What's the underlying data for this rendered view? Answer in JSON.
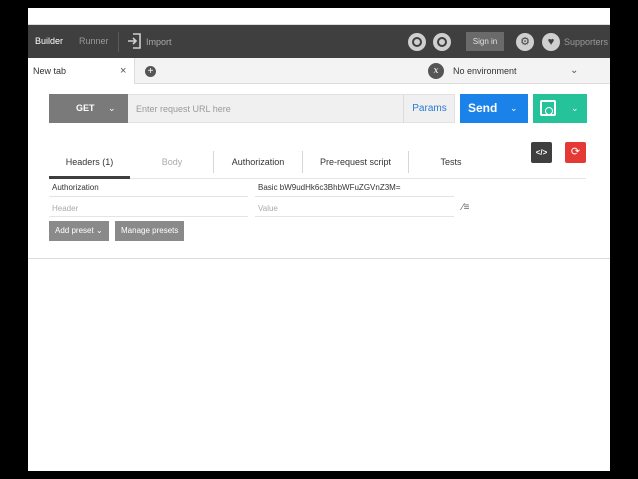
{
  "header": {
    "builder": "Builder",
    "runner": "Runner",
    "import": "Import",
    "sign_in": "Sign in",
    "supporters": "Supporters"
  },
  "tabs": {
    "active": "New tab",
    "close": "×",
    "add": "+"
  },
  "environment": {
    "icon_letter": "x",
    "label": "No environment"
  },
  "request": {
    "method": "GET",
    "url_placeholder": "Enter request URL here",
    "url_value": "",
    "params": "Params",
    "send": "Send"
  },
  "request_tabs": [
    {
      "label": "Headers (1)"
    },
    {
      "label": "Body"
    },
    {
      "label": "Authorization"
    },
    {
      "label": "Pre-request script"
    },
    {
      "label": "Tests"
    }
  ],
  "code_button": "</>",
  "headers_rows": [
    {
      "key": "Authorization",
      "value": "Basic bW9udHk6c3BhbWFuZGVnZ3M="
    },
    {
      "key_placeholder": "Header",
      "value_placeholder": "Value"
    }
  ],
  "presets": {
    "add": "Add preset",
    "manage": "Manage presets"
  },
  "colors": {
    "header_bg": "#3f3f3f",
    "send_blue": "#1a82e8",
    "save_green": "#26c29a",
    "reset_red": "#e53935",
    "params_blue": "#2a7ad4"
  },
  "icons": {
    "import": "import-icon",
    "sync": "sync-icon",
    "interceptor": "interceptor-icon",
    "settings": "wrench-icon",
    "supporters": "heart-icon",
    "save": "save-icon",
    "code": "code-icon",
    "reset": "refresh-icon",
    "bulk_edit": "bulk-edit-icon"
  }
}
